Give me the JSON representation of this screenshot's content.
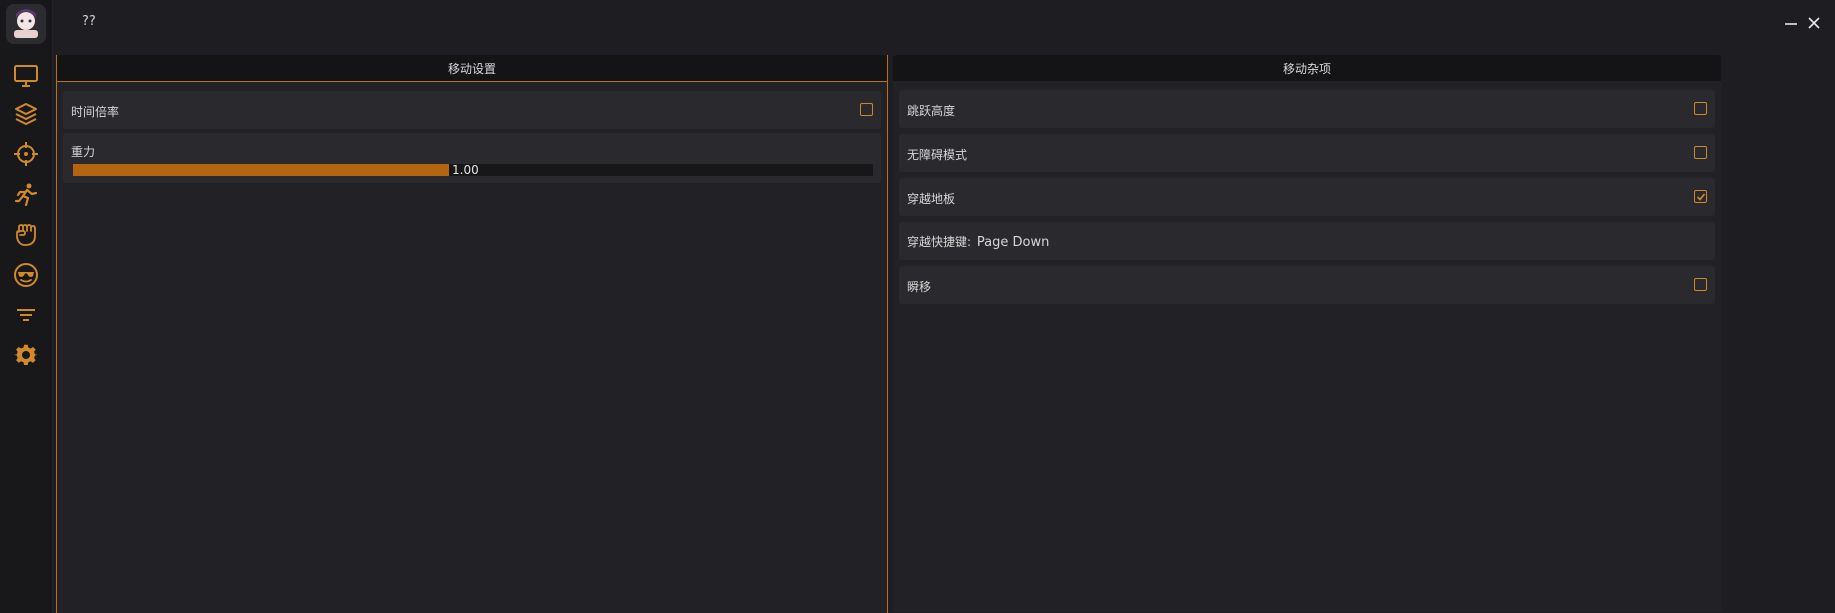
{
  "window": {
    "title": "??"
  },
  "sidebar": {
    "items": [
      {
        "icon": "monitor-icon"
      },
      {
        "icon": "layers-icon"
      },
      {
        "icon": "crosshair-icon"
      },
      {
        "icon": "running-figure-icon"
      },
      {
        "icon": "fist-icon"
      },
      {
        "icon": "sunglasses-face-icon"
      },
      {
        "icon": "filter-icon"
      },
      {
        "icon": "gear-icon"
      }
    ]
  },
  "colors": {
    "accent": "#b5650f",
    "accent_border": "#c98a2a",
    "background": "#1e1e22",
    "row_background": "#2a2a2e"
  },
  "left_panel": {
    "title": "移动设置",
    "time_scale": {
      "label": "时间倍率",
      "checked": false
    },
    "gravity": {
      "label": "重力",
      "value_text": "1.00",
      "fill_fraction": 0.47
    }
  },
  "right_panel": {
    "title": "移动杂项",
    "jump_height": {
      "label": "跳跃高度",
      "checked": false
    },
    "no_obstacle_mode": {
      "label": "无障碍模式",
      "checked": false
    },
    "through_floor": {
      "label": "穿越地板",
      "checked": true
    },
    "through_hotkey": {
      "label": "穿越快捷键:",
      "value": "Page Down"
    },
    "teleport": {
      "label": "瞬移",
      "checked": false
    }
  }
}
